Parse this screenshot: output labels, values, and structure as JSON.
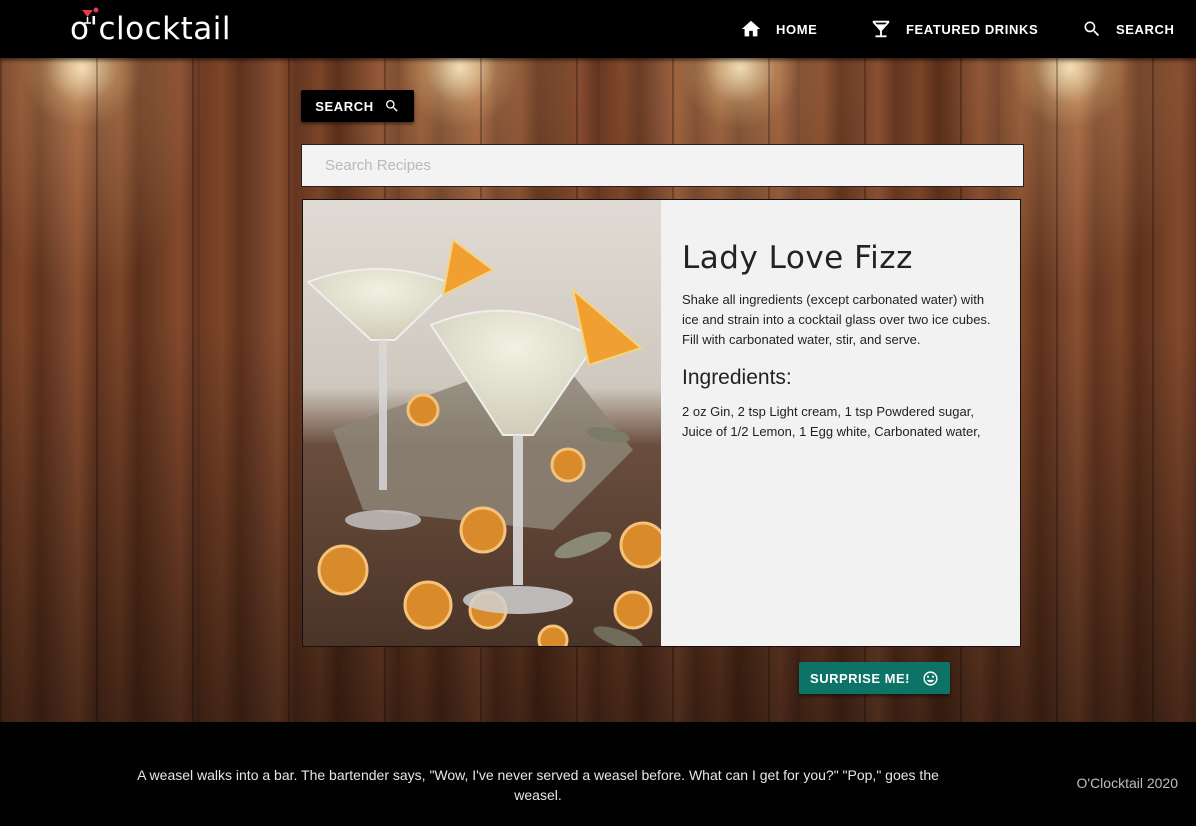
{
  "header": {
    "logo_text": "o'clocktail",
    "nav": {
      "home": "HOME",
      "featured": "FEATURED DRINKS",
      "search": "SEARCH"
    }
  },
  "search": {
    "button_label": "SEARCH",
    "placeholder": "Search Recipes"
  },
  "drink": {
    "name": "Lady Love Fizz",
    "instructions": "Shake all ingredients (except carbonated water) with ice and strain into a cocktail glass over two ice cubes. Fill with carbonated water, stir, and serve.",
    "ingredients_heading": "Ingredients:",
    "ingredients": "2 oz Gin, 2 tsp Light cream, 1 tsp Powdered sugar, Juice of 1/2 Lemon, 1 Egg white, Carbonated water,"
  },
  "surprise": {
    "label": "SURPRISE ME!"
  },
  "footer": {
    "joke": "A weasel walks into a bar. The bartender says, \"Wow, I've never served a weasel before. What can I get for you?\" \"Pop,\" goes the weasel.",
    "copyright": "O'Clocktail 2020"
  },
  "colors": {
    "surprise_button": "#0d7367",
    "header": "#000000",
    "card": "#f2f2f2"
  },
  "icons": {
    "home": "home-icon",
    "featured": "cocktail-glass-icon",
    "search": "search-icon",
    "surprise": "smiley-icon"
  }
}
